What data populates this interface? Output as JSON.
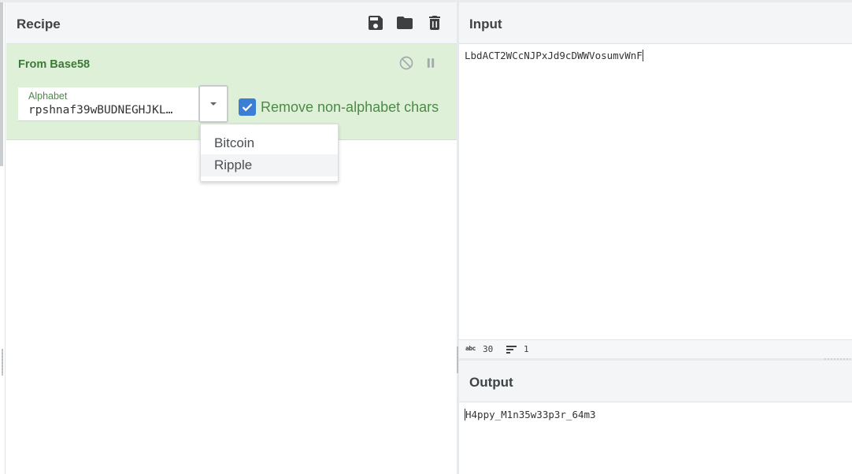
{
  "recipe": {
    "title": "Recipe",
    "toolbar_icons": [
      "save-icon",
      "folder-icon",
      "trash-icon"
    ]
  },
  "operation": {
    "name": "From Base58",
    "controls": [
      "disable-icon",
      "pause-icon"
    ],
    "alphabet": {
      "label": "Alphabet",
      "value": "rpshnaf39wBUDNEGHJKL…"
    },
    "remove_non_alphabet": {
      "label": "Remove non-alphabet chars",
      "checked": true
    },
    "dropdown_options": [
      "Bitcoin",
      "Ripple"
    ],
    "highlighted_option": "Ripple"
  },
  "input": {
    "title": "Input",
    "text": "LbdACT2WCcNJPxJd9cDWWVosumvWnF",
    "status": {
      "char_icon": "abc",
      "length": "30",
      "lines": "1"
    }
  },
  "output": {
    "title": "Output",
    "text": "H4ppy_M1n35w33p3r_64m3"
  },
  "colors": {
    "operation_bg": "#dff0d8",
    "operation_text": "#3c7a38",
    "checkbox": "#3a7fd5"
  }
}
